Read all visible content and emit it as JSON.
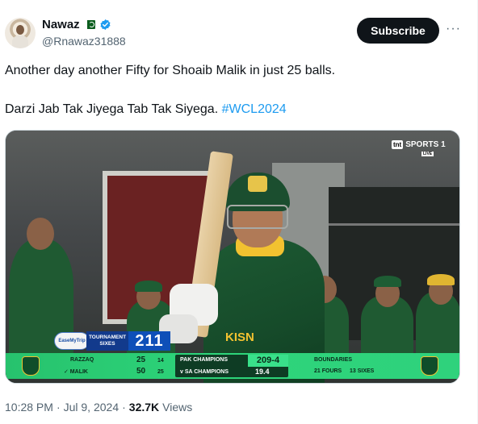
{
  "author": {
    "name": "Nawaz",
    "handle": "@Rnawaz31888",
    "badge_icons": [
      "pakistan-flag-icon",
      "verified-badge-icon"
    ],
    "verified_color": "#1d9bf0"
  },
  "actions": {
    "subscribe_label": "Subscribe",
    "more_label": "···"
  },
  "tweet": {
    "line1": "Another day another Fifty for Shoaib Malik in just 25 balls.",
    "line2": "Darzi Jab Tak Jiyega Tab Tak Siyega.",
    "hashtag": "#WCL2024"
  },
  "media": {
    "broadcaster": "SPORTS 1",
    "broadcaster_logo": "tnt",
    "live_tag": "LIVE",
    "kit_text": "KISN",
    "sponsor": "EaseMyTrip",
    "tournament_label_1": "TOURNAMENT",
    "tournament_label_2": "SIXES",
    "tournament_sixes": "211",
    "batters": [
      {
        "name": "RAZZAQ",
        "runs": "25",
        "balls": "14"
      },
      {
        "name": "✓ MALIK",
        "runs": "50",
        "balls": "25"
      }
    ],
    "team": "PAK CHAMPIONS",
    "score": "209-4",
    "opponent": "v SA CHAMPIONS",
    "overs": "19.4",
    "boundaries_label": "BOUNDARIES",
    "fours": "21 FOURS",
    "sixes": "13 SIXES",
    "colors": {
      "scorebar": "#2dd47a",
      "team_dark": "#0e3c24",
      "tournament": "#0e4fb8"
    }
  },
  "meta": {
    "time": "10:28 PM",
    "separator": "·",
    "date": "Jul 9, 2024",
    "views_count": "32.7K",
    "views_label": "Views"
  }
}
